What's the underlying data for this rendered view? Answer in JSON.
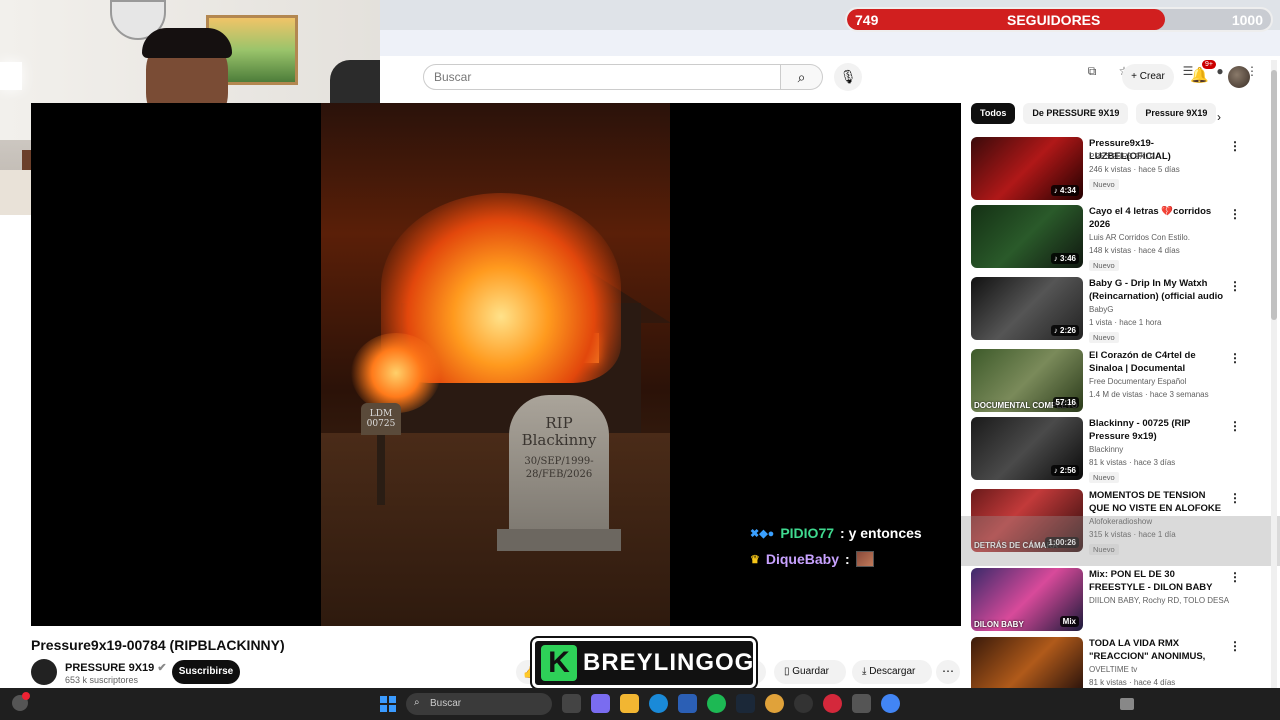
{
  "overlay": {
    "followers_current": "749",
    "followers_label": "SEGUIDORES",
    "followers_goal": "1000",
    "progress_fraction": 0.749
  },
  "header": {
    "search_placeholder": "Buscar",
    "create_label": "Crear",
    "notif_badge": "9+"
  },
  "video": {
    "mailbox_text": "LDM\n00725",
    "tomb_rip": "RIP",
    "tomb_name": "Blackinny",
    "tomb_date1": "30/SEP/1999-",
    "tomb_date2": "28/FEB/2026",
    "title": "Pressure9x19-00784 (RIPBLACKINNY)",
    "channel_name": "PRESSURE 9X19",
    "channel_subs": "653 k suscriptores",
    "subscribe_label": "Suscribirse",
    "save_label": "Guardar",
    "download_label": "Descargar",
    "share_tail": "ar"
  },
  "chat": [
    {
      "user": "PIDIO77",
      "msg": ": y entonces"
    },
    {
      "user": "DiqueBaby",
      "msg": ":"
    }
  ],
  "brand": {
    "letter": "K",
    "name": "BREYLINGOG"
  },
  "sidebar": {
    "chips": [
      "Todos",
      "De PRESSURE 9X19",
      "Pressure 9X19"
    ],
    "items": [
      {
        "title": "Pressure9x19-LUZBEL(OFICIAL)",
        "channel": "PRESSURE 9X19",
        "meta": "246 k vistas · hace 5 días",
        "badge": "Nuevo",
        "duration": "♪ 4:34",
        "thumb_text": ""
      },
      {
        "title": "Cayo el 4 letras 💔corridos 2026",
        "channel": "Luis AR Corridos Con Estilo.",
        "meta": "148 k vistas · hace 4 días",
        "badge": "Nuevo",
        "duration": "♪ 3:46",
        "thumb_text": ""
      },
      {
        "title": "Baby G - Drip In My Watxh (Reincarnation) (official audio ...",
        "channel": "BabyG",
        "meta": "1 vista · hace 1 hora",
        "badge": "Nuevo",
        "duration": "♪ 2:26",
        "thumb_text": ""
      },
      {
        "title": "El Corazón de C4rtel de Sinaloa | Documental Completo",
        "channel": "Free Documentary Español",
        "meta": "1.4 M de vistas · hace 3 semanas",
        "badge": "",
        "duration": "57:16",
        "thumb_text": "DOCUMENTAL COMPLETO"
      },
      {
        "title": "Blackinny - 00725 (RIP Pressure 9x19)",
        "channel": "Blackinny",
        "meta": "81 k vistas · hace 3 días",
        "badge": "Nuevo",
        "duration": "♪ 2:56",
        "thumb_text": ""
      },
      {
        "title": "MOMENTOS DE TENSION QUE NO VISTE EN ALOFOKE EN EL ...",
        "channel": "Alofokeradioshow",
        "meta": "315 k vistas · hace 1 día",
        "badge": "Nuevo",
        "duration": "1:00:26",
        "thumb_text": "DETRÁS DE CÁMARA"
      },
      {
        "title": "Mix: PON EL DE 30 FREESTYLE - DILON BABY ❌ DJ SCUFF",
        "channel": "DIILON BABY, Rochy RD, TOLO DESAPAR...",
        "meta": "",
        "badge": "",
        "duration": "Mix",
        "thumb_text": "DILON BABY"
      },
      {
        "title": "TODA LA VIDA RMX \"REACCION\" ANONIMUS, LUA...",
        "channel": "OVELTIME tv",
        "meta": "81 k vistas · hace 4 días",
        "badge": "",
        "duration": "",
        "thumb_text": "EL MEJOR REMIX DEL"
      }
    ]
  },
  "taskbar": {
    "search_placeholder": "Buscar"
  }
}
